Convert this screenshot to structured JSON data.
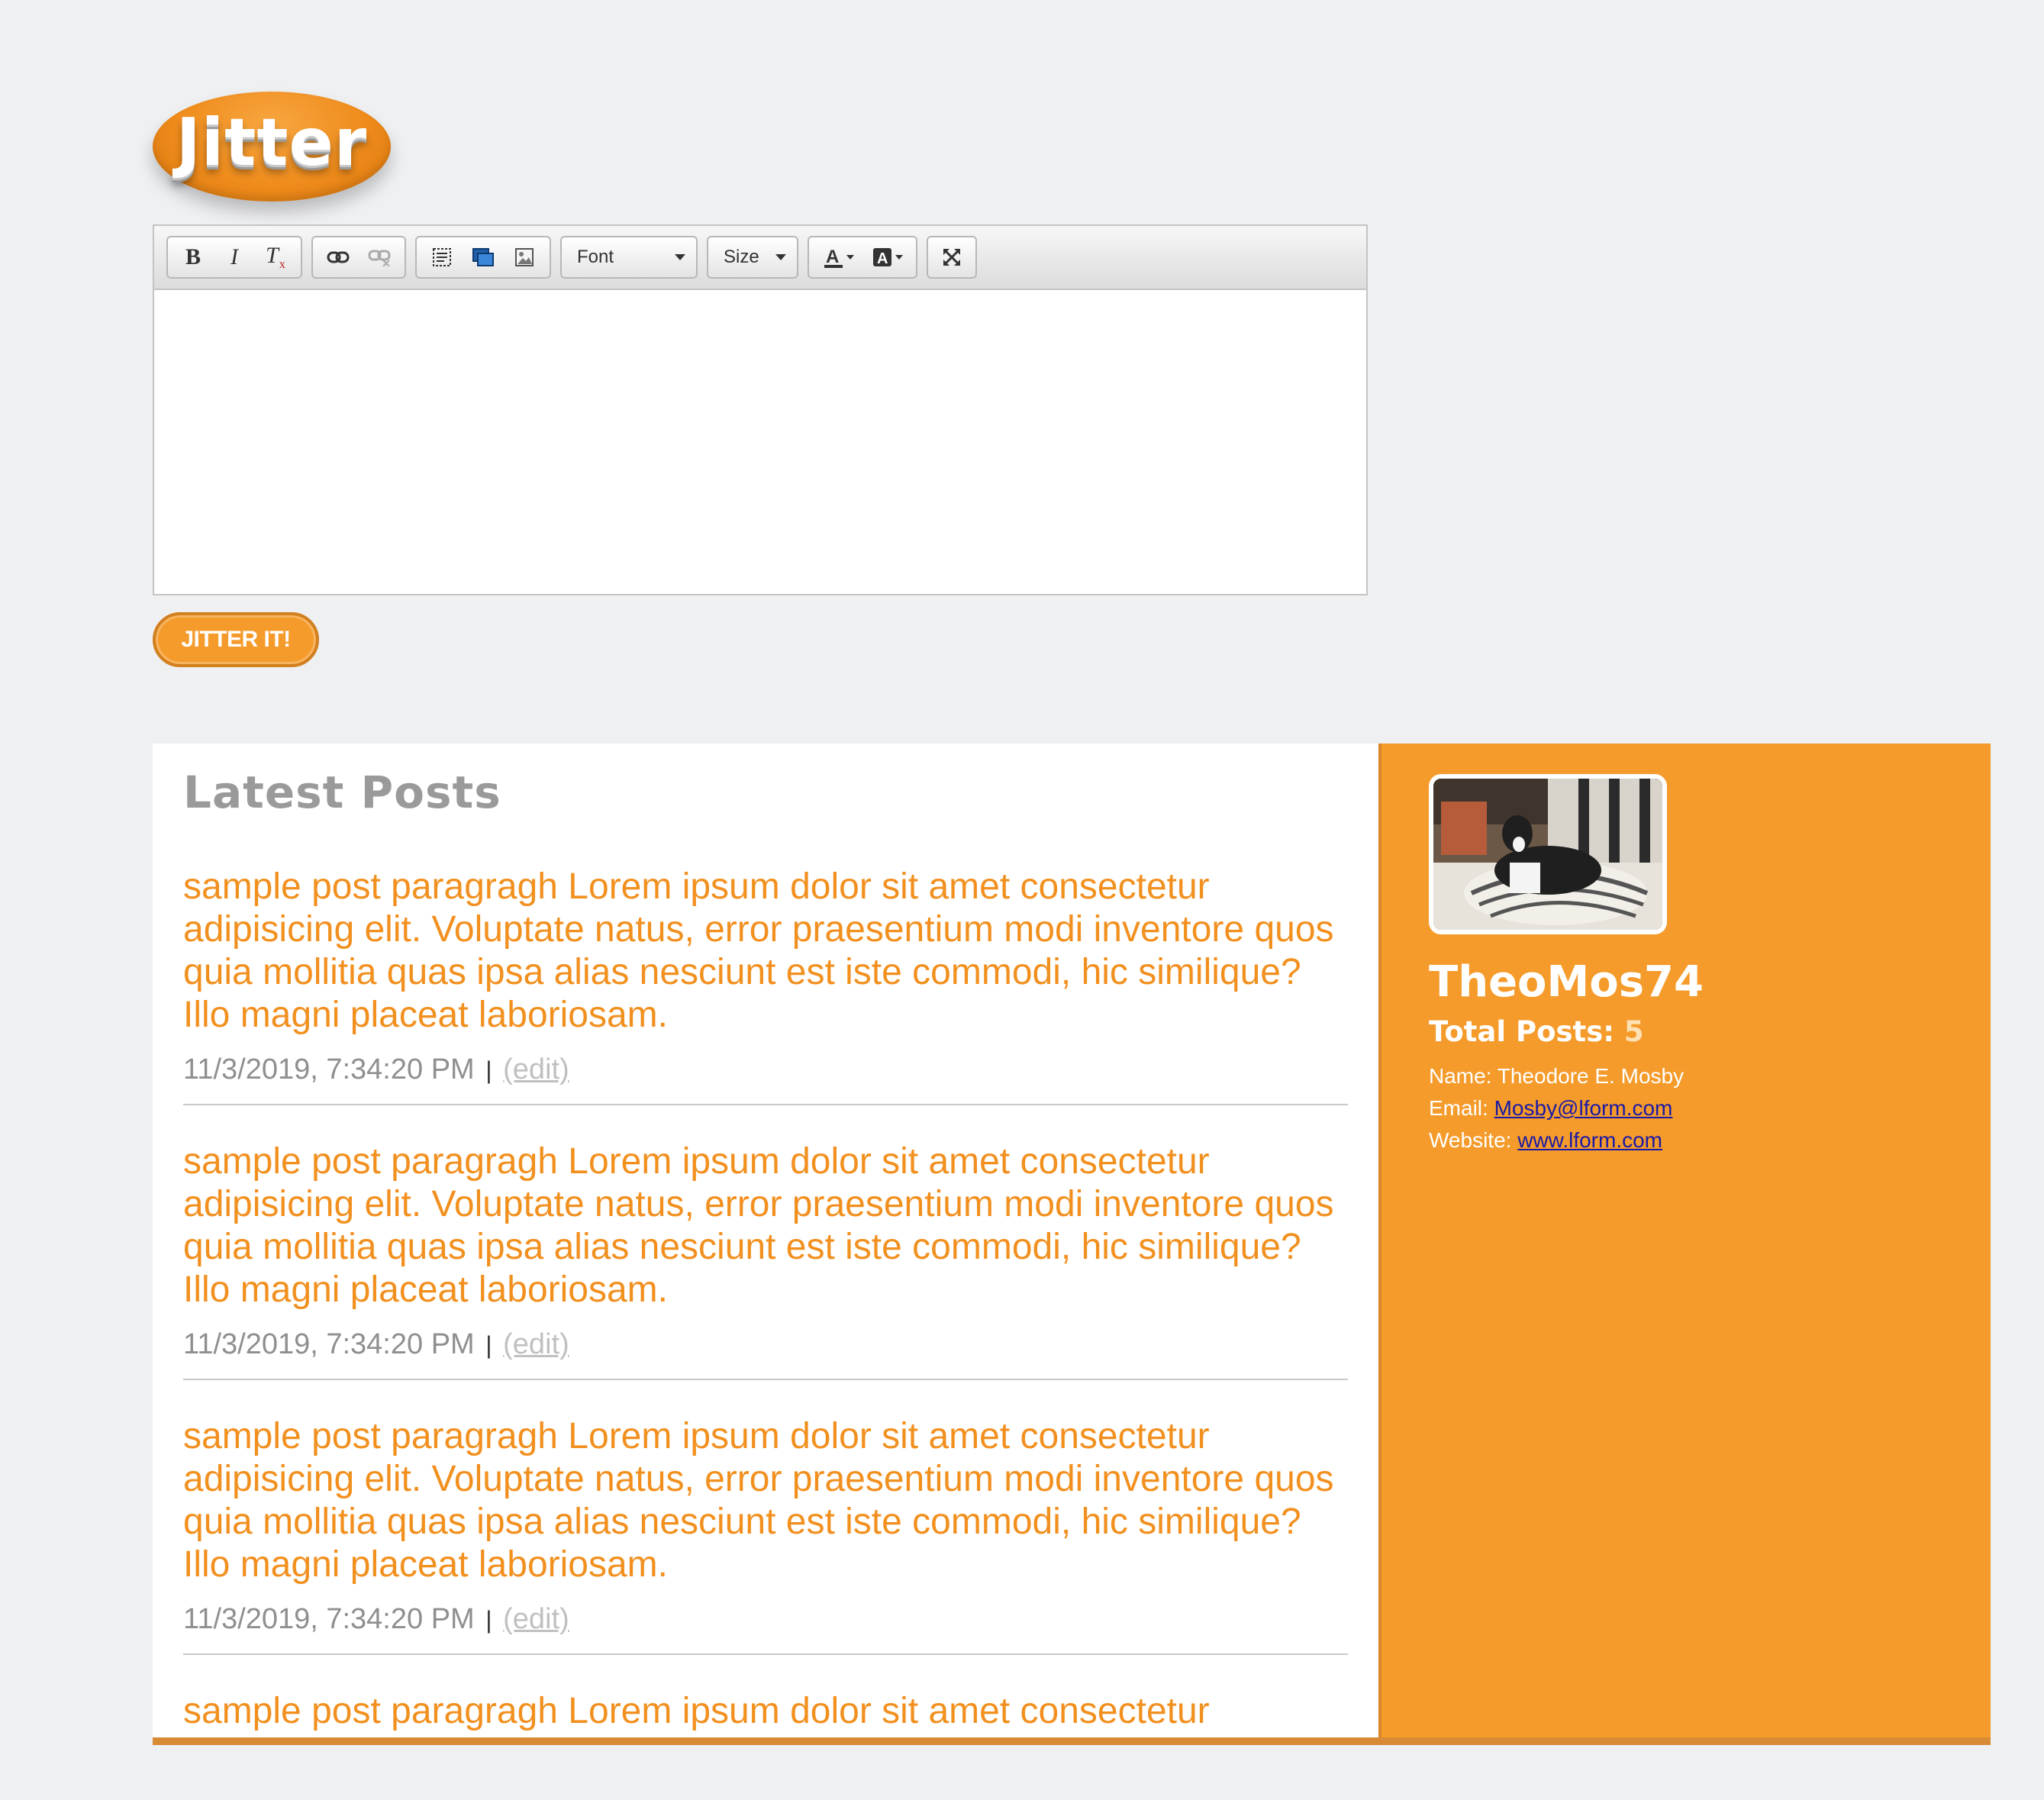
{
  "brand": {
    "logo_text": "Jitter"
  },
  "editor": {
    "toolbar": {
      "bold": "B",
      "italic": "I",
      "remove_format": "T",
      "font_label": "Font",
      "size_label": "Size"
    },
    "content": ""
  },
  "submit_label": "JITTER IT!",
  "posts": {
    "title": "Latest Posts",
    "items": [
      {
        "text": "sample post paragragh Lorem ipsum dolor sit amet consectetur adipisicing elit. Voluptate natus, error praesentium modi inventore quos quia mollitia quas ipsa alias nesciunt est iste commodi, hic similique? Illo magni placeat laboriosam.",
        "timestamp": "11/3/2019, 7:34:20 PM",
        "separator": "|",
        "edit_label": "(edit)"
      },
      {
        "text": "sample post paragragh Lorem ipsum dolor sit amet consectetur adipisicing elit. Voluptate natus, error praesentium modi inventore quos quia mollitia quas ipsa alias nesciunt est iste commodi, hic similique? Illo magni placeat laboriosam.",
        "timestamp": "11/3/2019, 7:34:20 PM",
        "separator": "|",
        "edit_label": "(edit)"
      },
      {
        "text": "sample post paragragh Lorem ipsum dolor sit amet consectetur adipisicing elit. Voluptate natus, error praesentium modi inventore quos quia mollitia quas ipsa alias nesciunt est iste commodi, hic similique? Illo magni placeat laboriosam.",
        "timestamp": "11/3/2019, 7:34:20 PM",
        "separator": "|",
        "edit_label": "(edit)"
      },
      {
        "text": "sample post paragragh Lorem ipsum dolor sit amet consectetur adipisicing elit. Voluptate natus, error praesentium modi inventore quos quia mollitia quas ipsa alias nesciunt est iste commodi, hic similique? Illo magni placeat laboriosam.",
        "timestamp": "",
        "separator": "",
        "edit_label": ""
      }
    ]
  },
  "profile": {
    "username": "TheoMos74",
    "total_posts_label": "Total Posts:",
    "total_posts_count": "5",
    "name_label": "Name:",
    "name_value": "Theodore E. Mosby",
    "email_label": "Email:",
    "email_value": "Mosby@lform.com",
    "website_label": "Website:",
    "website_value": "www.lform.com"
  },
  "colors": {
    "accent": "#f59b2b",
    "post_text": "#f2901f",
    "background": "#eff0f2",
    "link": "#1a1aa6"
  },
  "icons": [
    "bold-icon",
    "italic-icon",
    "remove-format-icon",
    "link-icon",
    "unlink-icon",
    "select-all-icon",
    "flash-icon",
    "image-icon",
    "text-color-icon",
    "background-color-icon",
    "maximize-icon"
  ]
}
